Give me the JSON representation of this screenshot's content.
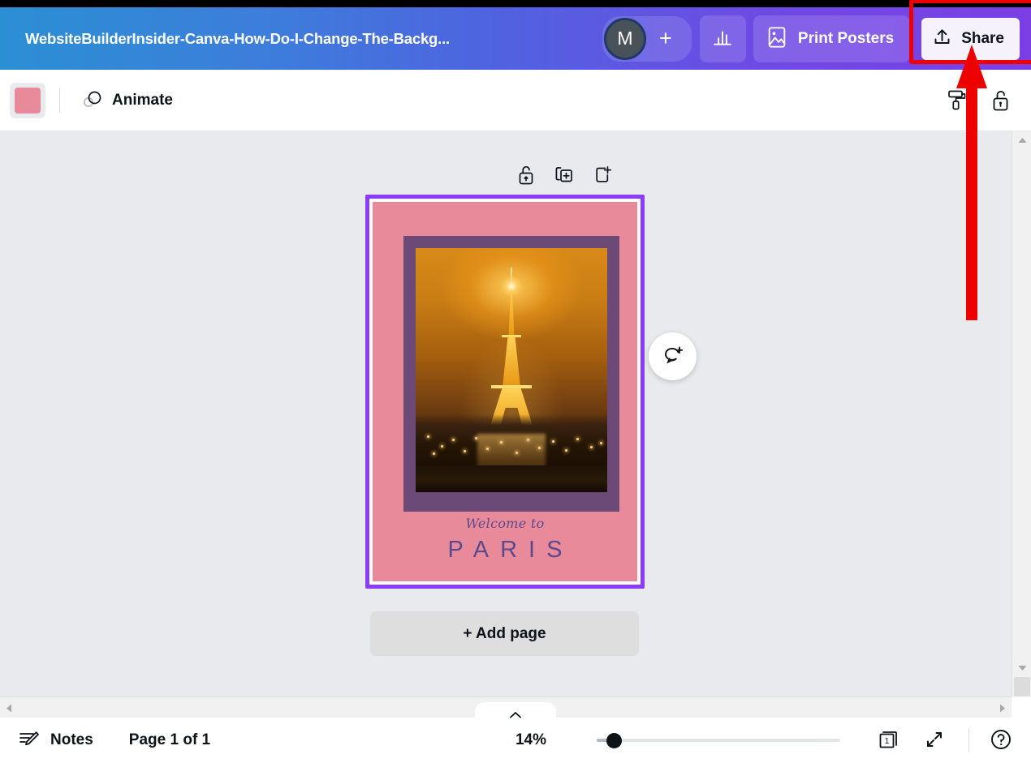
{
  "header": {
    "doc_title": "WebsiteBuilderInsider-Canva-How-Do-I-Change-The-Backg...",
    "avatar_initial": "M",
    "invite_label": "+",
    "analytics_icon": "bar-chart-icon",
    "print_posters_label": "Print Posters",
    "print_posters_icon": "poster-image-icon",
    "share_label": "Share",
    "share_icon": "upload-share-icon",
    "gradient_start": "#2b8fd4",
    "gradient_end": "#7b3fe4",
    "annotation_color": "#ee0000"
  },
  "toolbar": {
    "color_swatch_value": "#e88a9a",
    "color_swatch_name": "background-color-swatch",
    "animate_label": "Animate",
    "animate_icon": "animate-circles-icon",
    "paint_roller_icon": "paint-roller-icon",
    "lock_icon": "unlocked-padlock-icon"
  },
  "canvas": {
    "page_tools": [
      {
        "name": "unlock-page-icon",
        "label": "Unlock"
      },
      {
        "name": "duplicate-page-icon",
        "label": "Duplicate page"
      },
      {
        "name": "add-page-icon",
        "label": "Add page"
      }
    ],
    "comment_icon": "add-comment-icon",
    "add_page_label": "+ Add page",
    "selection_color": "#8b3dff",
    "poster": {
      "background_color": "#e88a9a",
      "frame_color": "#6b4a78",
      "script_text": "Welcome to",
      "title_text": "PARIS",
      "text_color": "#5d4a8c",
      "photo_alt": "Eiffel Tower at night with golden illuminated sky"
    }
  },
  "scrollbars": {
    "vertical_up": "scroll-up-arrow",
    "vertical_down": "scroll-down-arrow",
    "horizontal_left": "scroll-left-arrow",
    "horizontal_right": "scroll-right-arrow",
    "collapse_icon": "chevron-up-icon"
  },
  "bottombar": {
    "notes_label": "Notes",
    "notes_icon": "notes-pencil-icon",
    "page_indicator": "Page 1 of 1",
    "zoom_level": "14%",
    "page_count": "1",
    "page_count_icon": "pages-stack-icon",
    "expand_icon": "fullscreen-expand-icon",
    "help_icon": "help-question-icon"
  }
}
